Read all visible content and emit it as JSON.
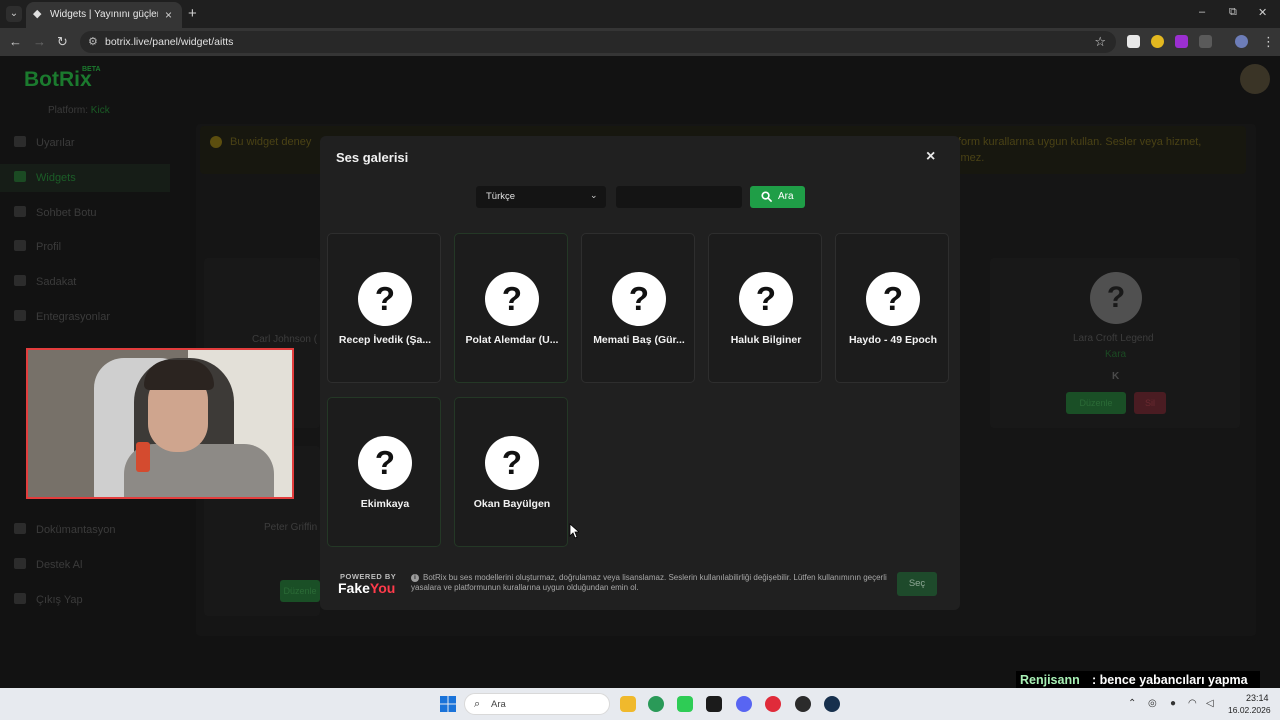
{
  "browser": {
    "tab_title": "Widgets | Yayınını güçlendirmek",
    "url": "botrix.live/panel/widget/aitts"
  },
  "app": {
    "logo": "BotRix",
    "logo_badge": "BETA",
    "platform_label": "Platform:",
    "platform_value": "Kick",
    "sidebar": [
      "Uyarılar",
      "Widgets",
      "Sohbet Botu",
      "Profil",
      "Sadakat",
      "Entegrasyonlar",
      "Dokümantasyon",
      "Destek Al",
      "Çıkış Yap"
    ],
    "warning_left": "Bu widget deney",
    "warning_right": "form kurallarına uygun kullan. Sesler veya hizmet,",
    "warning_right2": "imez.",
    "bg_cards": [
      {
        "name": "Carl Johnson ("
      },
      {
        "name": "Lara Croft Legend",
        "sub": "Kara",
        "edit": "Düzenle",
        "delete": "Sil"
      },
      {
        "name": "Peter Griffin"
      }
    ],
    "bg_button_left": "Düzenle"
  },
  "modal": {
    "title": "Ses galerisi",
    "close": "×",
    "language": "Türkçe",
    "search_value": "",
    "search_button": "Ara",
    "voices": [
      "Recep İvedik (Şa...",
      "Polat Alemdar (U...",
      "Memati Baş (Gür...",
      "Haluk Bilginer",
      "Haydo - 49 Epoch",
      "Ekimkaya",
      "Okan Bayülgen"
    ],
    "powered_by": "POWERED BY",
    "brand_a": "Fake",
    "brand_b": "You",
    "disclaimer": "BotRix bu ses modellerini oluşturmaz, doğrulamaz veya lisanslamaz. Seslerin kullanılabilirliği değişebilir. Lütfen kullanımının geçerli yasalara ve platformunun kurallarına uygun olduğundan emin ol.",
    "select_button": "Seç"
  },
  "chat": {
    "user": "Renjisann",
    "message": ": bence yabancıları yapma"
  },
  "taskbar": {
    "search_placeholder": "Ara",
    "time": "23:14",
    "date": "16.02.2026"
  },
  "colors": {
    "accent_green": "#1f9e47",
    "webcam_border": "#e33d3d",
    "chat_user": "#a8f0b5"
  }
}
